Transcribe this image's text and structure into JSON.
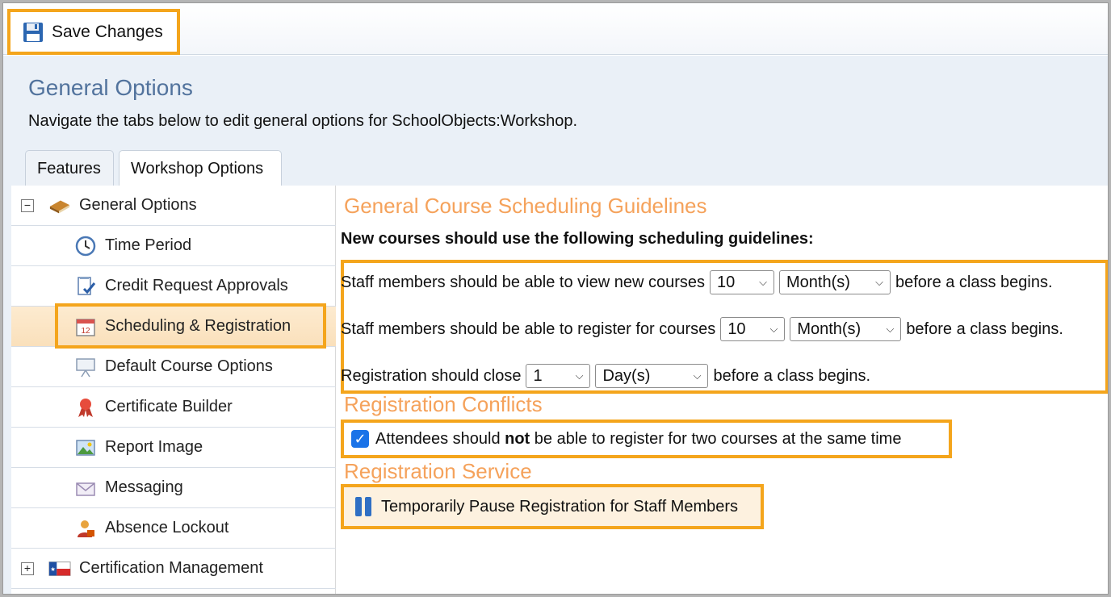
{
  "toolbar": {
    "save_label": "Save Changes"
  },
  "page": {
    "title": "General Options",
    "description": "Navigate the tabs below to edit general options for SchoolObjects:Workshop."
  },
  "tabs": [
    {
      "label": "Features",
      "active": false
    },
    {
      "label": "Workshop Options",
      "active": true
    }
  ],
  "tree": {
    "general": {
      "label": "General Options",
      "expander": "−",
      "icon": "book-icon"
    },
    "items": [
      {
        "label": "Time Period",
        "icon": "clock-icon"
      },
      {
        "label": "Credit Request Approvals",
        "icon": "document-check-icon"
      },
      {
        "label": "Scheduling & Registration",
        "icon": "calendar-icon",
        "selected": true
      },
      {
        "label": "Default Course Options",
        "icon": "presentation-icon"
      },
      {
        "label": "Certificate Builder",
        "icon": "ribbon-icon"
      },
      {
        "label": "Report Image",
        "icon": "image-icon"
      },
      {
        "label": "Messaging",
        "icon": "envelope-icon"
      },
      {
        "label": "Absence Lockout",
        "icon": "user-lock-icon"
      }
    ],
    "certification": {
      "label": "Certification Management",
      "expander": "+",
      "icon": "flag-icon"
    }
  },
  "scheduling": {
    "title": "General Course Scheduling Guidelines",
    "intro": "New courses should use the following scheduling guidelines:",
    "rows": [
      {
        "prefix": "Staff members should be able to view new courses",
        "number": "10",
        "unit": "Month(s)",
        "suffix": "before a class begins."
      },
      {
        "prefix": "Staff members should be able to register for courses",
        "number": "10",
        "unit": "Month(s)",
        "suffix": "before a class begins."
      },
      {
        "prefix": "Registration should close",
        "number": "1",
        "unit": "Day(s)",
        "suffix": "before a class begins."
      }
    ]
  },
  "conflicts": {
    "title": "Registration Conflicts",
    "checked": true,
    "text_before": "Attendees should",
    "text_bold": "not",
    "text_after": "be able to register for two courses at the same time"
  },
  "service": {
    "title": "Registration Service",
    "pause_label": "Temporarily Pause Registration for Staff Members"
  },
  "colors": {
    "highlight": "#f4a51c",
    "section_title": "#f5a25b",
    "page_title": "#52739d"
  }
}
